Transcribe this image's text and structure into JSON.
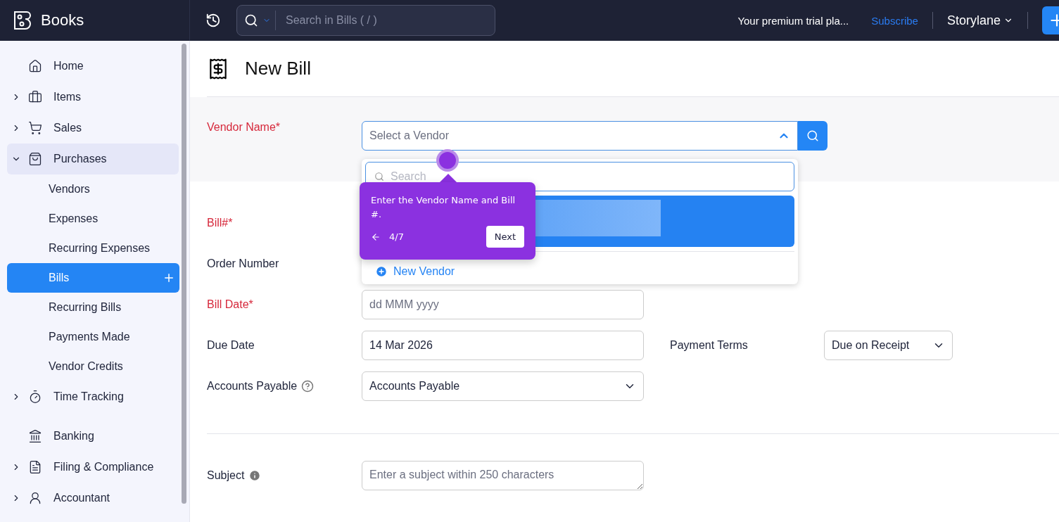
{
  "topbar": {
    "app_name": "Books",
    "search": {
      "placeholder": "Search in Bills ( / )"
    },
    "trial_text": "Your premium trial pla...",
    "subscribe": "Subscribe",
    "org": "Storylane"
  },
  "sidebar": {
    "items": [
      {
        "label": "Home",
        "selected": false
      },
      {
        "label": "Items",
        "expanded": false,
        "selected": false
      },
      {
        "label": "Sales",
        "expanded": false,
        "selected": false
      },
      {
        "label": "Purchases",
        "expanded": true,
        "selected": true,
        "children": [
          {
            "label": "Vendors",
            "selected": false
          },
          {
            "label": "Expenses",
            "selected": false
          },
          {
            "label": "Recurring Expenses",
            "selected": false
          },
          {
            "label": "Bills",
            "selected": true
          },
          {
            "label": "Recurring Bills",
            "selected": false
          },
          {
            "label": "Payments Made",
            "selected": false
          },
          {
            "label": "Vendor Credits",
            "selected": false
          }
        ]
      },
      {
        "label": "Time Tracking",
        "expanded": false,
        "selected": false
      },
      {
        "label": "Banking",
        "selected": false
      },
      {
        "label": "Filing & Compliance",
        "expanded": false,
        "selected": false
      },
      {
        "label": "Accountant",
        "expanded": false,
        "selected": false
      }
    ]
  },
  "page": {
    "title": "New Bill"
  },
  "vendor": {
    "label": "Vendor Name*",
    "placeholder": "Select a Vendor",
    "dropdown": {
      "search_placeholder": "Search",
      "new_vendor": "New Vendor"
    }
  },
  "fields": [
    {
      "label": "Bill#*",
      "required": true,
      "kind": "hidden"
    },
    {
      "label": "Order Number",
      "required": false,
      "kind": "hidden"
    },
    {
      "label": "Bill Date*",
      "required": true,
      "kind": "text",
      "placeholder": "dd MMM yyyy"
    },
    {
      "label": "Due Date",
      "required": false,
      "kind": "text",
      "value": "14 Mar 2026",
      "extra": {
        "label": "Payment Terms",
        "value": "Due on Receipt"
      }
    },
    {
      "label": "Accounts Payable",
      "required": false,
      "kind": "select",
      "value": "Accounts Payable",
      "help": true
    }
  ],
  "subject": {
    "label": "Subject",
    "placeholder": "Enter a subject within 250 characters"
  },
  "tour": {
    "text": "Enter the Vendor Name and Bill #.",
    "step": "4/7",
    "next": "Next"
  }
}
